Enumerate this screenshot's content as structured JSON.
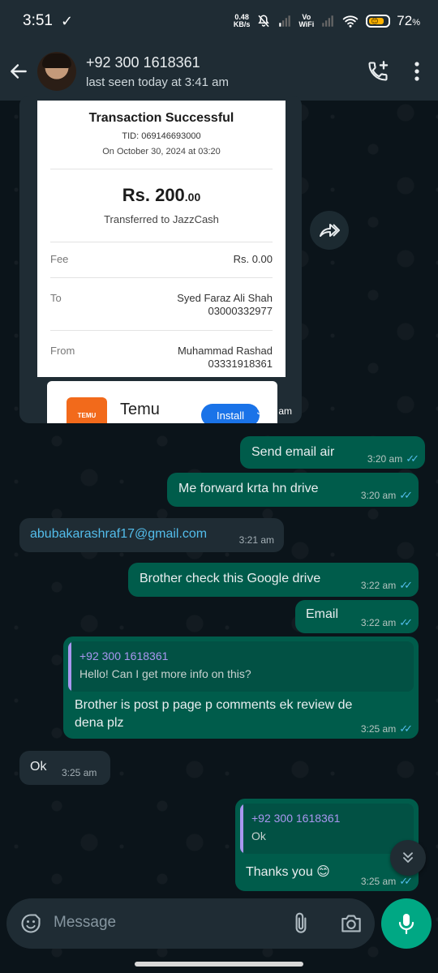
{
  "status_bar": {
    "time": "3:51",
    "net_speed_value": "0.48",
    "net_speed_unit": "KB/s",
    "vowifi_top": "Vo",
    "vowifi_bottom": "WiFi",
    "battery": "72",
    "battery_unit": "%"
  },
  "header": {
    "contact_name": "+92 300 1618361",
    "last_seen": "last seen today at 3:41 am"
  },
  "receipt": {
    "title": "Transaction Successful",
    "tid": "TID: 069146693000",
    "date": "On October 30, 2024 at 03:20",
    "amount_main": "Rs. 200",
    "amount_decimal": ".00",
    "transfer_note": "Transferred to JazzCash",
    "fee_label": "Fee",
    "fee_value": "Rs. 0.00",
    "to_label": "To",
    "to_name": "Syed Faraz Ali Shah",
    "to_number": "03000332977",
    "from_label": "From",
    "from_name": "Muhammad Rashad",
    "from_number": "03331918361",
    "ad_brand": "Temu",
    "ad_logo_text": "TEMU",
    "ad_button": "Install",
    "time": "3:20 am"
  },
  "messages": [
    {
      "text": "Send email air",
      "time": "3:20 am"
    },
    {
      "text": "Me forward krta hn drive",
      "time": "3:20 am"
    },
    {
      "text": "abubakarashraf17@gmail.com",
      "time": "3:21 am"
    },
    {
      "text": "Brother check this Google drive",
      "time": "3:22 am"
    },
    {
      "text": "Email",
      "time": "3:22 am"
    },
    {
      "quote_name": "+92 300 1618361",
      "quote_text": "Hello! Can I get more info on this?",
      "text_line1": "Brother is post p page p comments ek review de",
      "text_line2": "dena plz",
      "time": "3:25 am"
    },
    {
      "text": "Ok",
      "time": "3:25 am"
    },
    {
      "quote_name": "+92 300 1618361",
      "quote_text": "Ok",
      "text": "Thanks you",
      "emoji": "😊",
      "time": "3:25 am"
    }
  ],
  "composer": {
    "placeholder": "Message"
  },
  "colors": {
    "outgoing_bubble": "#005c4b",
    "incoming_bubble": "#1f2c34",
    "read_ticks": "#53bdeb",
    "link": "#53bdeb",
    "mic_button": "#00a884"
  }
}
